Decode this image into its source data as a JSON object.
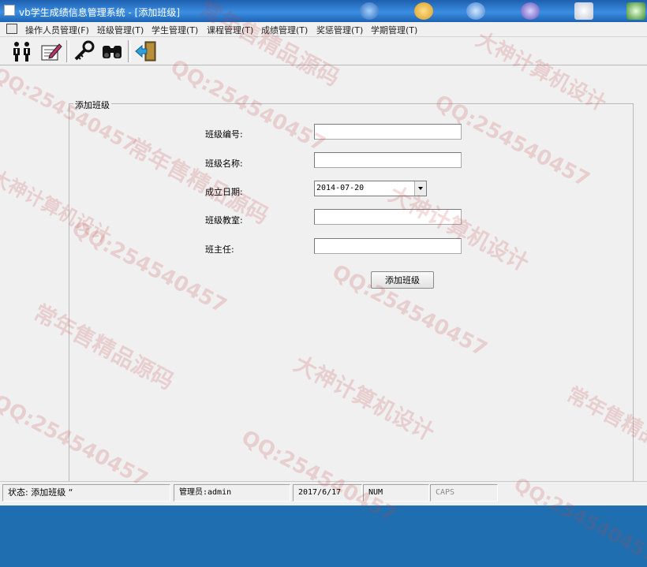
{
  "window": {
    "title": "vb学生成绩信息管理系统 - [添加班级]"
  },
  "menu": [
    {
      "label": "操作人员管理(F)"
    },
    {
      "label": "班级管理(T)"
    },
    {
      "label": "学生管理(T)"
    },
    {
      "label": "课程管理(T)"
    },
    {
      "label": "成绩管理(T)"
    },
    {
      "label": "奖惩管理(T)"
    },
    {
      "label": "学期管理(T)"
    }
  ],
  "toolbar": {
    "buttons": [
      {
        "icon": "users-icon"
      },
      {
        "icon": "edit-form-icon"
      },
      {
        "icon": "key-icon"
      },
      {
        "icon": "binoculars-icon"
      },
      {
        "icon": "exit-door-icon"
      }
    ]
  },
  "form": {
    "title": "添加班级",
    "fields": {
      "class_id": {
        "label": "班级编号:",
        "value": ""
      },
      "class_name": {
        "label": "班级名称:",
        "value": ""
      },
      "founded_date": {
        "label": "成立日期:",
        "value": "2014-07-20"
      },
      "classroom": {
        "label": "班级教室:",
        "value": ""
      },
      "head_teacher": {
        "label": "班主任:",
        "value": ""
      }
    },
    "submit_label": "添加班级"
  },
  "status": {
    "state": "状态:   添加班级 “",
    "admin": "管理员:admin",
    "date": "2017/6/17",
    "num": "NUM",
    "caps": "CAPS"
  },
  "watermark": {
    "qq": "QQ:254540457",
    "shop": "常年售精品源码",
    "brand": "大神计算机设计"
  }
}
